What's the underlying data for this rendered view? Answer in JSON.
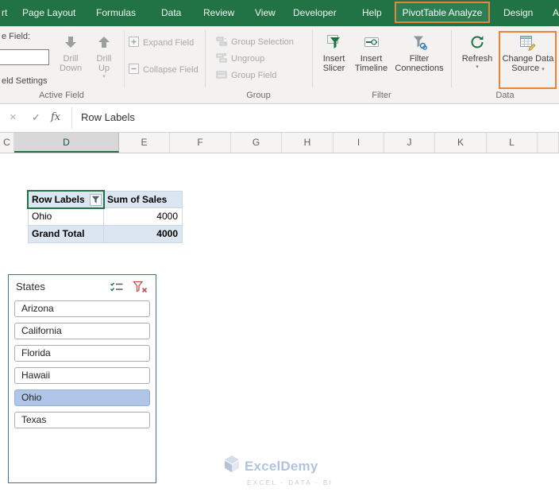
{
  "colors": {
    "excel_green": "#217346",
    "highlight_orange": "#e8833a",
    "pivot_header_blue": "#dce6f1",
    "slicer_selected_blue": "#b0c6e8",
    "slicer_border_blue": "#41719c"
  },
  "glyphs": {
    "caret": "▾"
  },
  "tabbar": {
    "active_tab": "PivotTable Analyze",
    "tabs": [
      {
        "label": "rt"
      },
      {
        "label": "Page Layout"
      },
      {
        "label": "Formulas"
      },
      {
        "label": "Data"
      },
      {
        "label": "Review"
      },
      {
        "label": "View"
      },
      {
        "label": "Developer"
      },
      {
        "label": "Help"
      },
      {
        "label": "PivotTable Analyze"
      },
      {
        "label": "Design"
      },
      {
        "label": "A"
      }
    ]
  },
  "ribbon": {
    "active_field": {
      "caption_partial": "e Field:",
      "field_value": "",
      "settings_partial": "eld Settings",
      "drill_down_line1": "Drill",
      "drill_down_line2": "Down",
      "drill_up_line1": "Drill",
      "drill_up_line2": "Up",
      "expand_field": "Expand Field",
      "collapse_field": "Collapse Field",
      "group_label": "Active Field"
    },
    "group_group": {
      "group_selection": "Group Selection",
      "ungroup": "Ungroup",
      "group_field": "Group Field",
      "group_label": "Group"
    },
    "filter_group": {
      "insert_slicer_line1": "Insert",
      "insert_slicer_line2": "Slicer",
      "insert_timeline_line1": "Insert",
      "insert_timeline_line2": "Timeline",
      "filter_connections_line1": "Filter",
      "filter_connections_line2": "Connections",
      "group_label": "Filter"
    },
    "data_group": {
      "refresh": "Refresh",
      "change_line1": "Change Data",
      "change_line2": "Source",
      "group_label": "Data"
    }
  },
  "formula_bar": {
    "cancel": "×",
    "enter": "✓",
    "fx": "fx",
    "value": "Row Labels"
  },
  "columns": {
    "selected": "D",
    "headers": [
      "C",
      "D",
      "E",
      "F",
      "G",
      "H",
      "I",
      "J",
      "K",
      "L"
    ]
  },
  "pivot": {
    "header_row_labels": "Row Labels",
    "header_values": "Sum of Sales",
    "rows": [
      {
        "label": "Ohio",
        "value": "4000"
      },
      {
        "label": "Grand Total",
        "value": "4000"
      }
    ]
  },
  "slicer": {
    "title": "States",
    "items": [
      {
        "label": "Arizona",
        "selected": false
      },
      {
        "label": "California",
        "selected": false
      },
      {
        "label": "Florida",
        "selected": false
      },
      {
        "label": "Hawaii",
        "selected": false
      },
      {
        "label": "Ohio",
        "selected": true
      },
      {
        "label": "Texas",
        "selected": false
      }
    ]
  },
  "watermark": {
    "brand": "ExcelDemy",
    "tagline": "EXCEL · DATA · BI"
  }
}
